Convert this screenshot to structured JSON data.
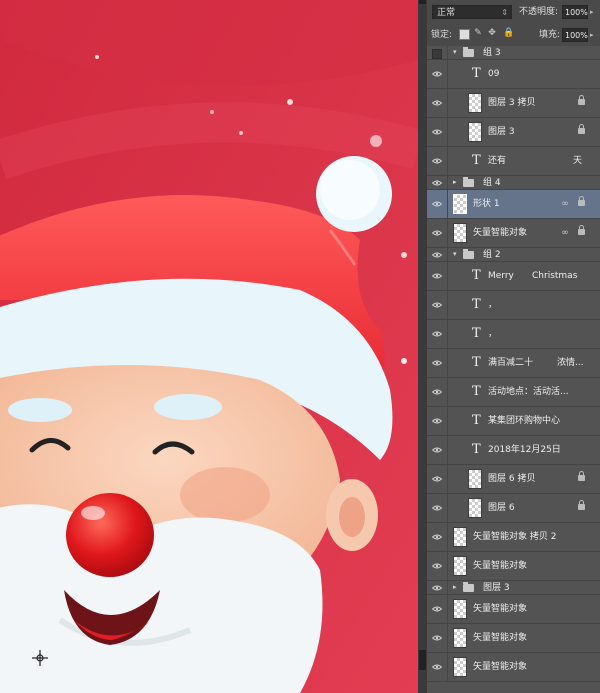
{
  "top_bar": {
    "blend_mode": "正常",
    "opacity_label": "不透明度:",
    "opacity_value": "100%",
    "lock_label": "锁定:",
    "fill_label": "填充:",
    "fill_value": "100%"
  },
  "layers": [
    {
      "kind": "group",
      "name": "组 3",
      "expanded": true,
      "indent": 0,
      "visible": false
    },
    {
      "kind": "text",
      "name": "09",
      "indent": 1,
      "visible": true
    },
    {
      "kind": "image",
      "name": "图层 3 拷贝",
      "indent": 1,
      "visible": true,
      "locked": true
    },
    {
      "kind": "image",
      "name": "图层 3",
      "indent": 1,
      "visible": true,
      "locked": true
    },
    {
      "kind": "text",
      "name": "还有",
      "extra": "天",
      "indent": 1,
      "visible": true
    },
    {
      "kind": "group",
      "name": "组 4",
      "expanded": false,
      "indent": 0,
      "visible": true
    },
    {
      "kind": "smart",
      "name": "形状 1",
      "indent": 0,
      "visible": true,
      "selected": true,
      "linked": true,
      "locked": true
    },
    {
      "kind": "smart",
      "name": "矢量智能对象",
      "indent": 0,
      "visible": true,
      "linked": true,
      "locked": true
    },
    {
      "kind": "group",
      "name": "组 2",
      "expanded": true,
      "indent": 0,
      "visible": true
    },
    {
      "kind": "text",
      "name": "Merry",
      "extra": "Christmas",
      "indent": 1,
      "visible": true
    },
    {
      "kind": "text",
      "name": "，",
      "indent": 1,
      "visible": true
    },
    {
      "kind": "text",
      "name": "，",
      "indent": 1,
      "visible": true
    },
    {
      "kind": "text",
      "name": "满百减二十",
      "extra": "浓情...",
      "indent": 1,
      "visible": true
    },
    {
      "kind": "text",
      "name": "活动地点：活动活...",
      "indent": 1,
      "visible": true
    },
    {
      "kind": "text",
      "name": "某集团环购物中心",
      "indent": 1,
      "visible": true
    },
    {
      "kind": "text",
      "name": "2018年12月25日",
      "indent": 1,
      "visible": true
    },
    {
      "kind": "image",
      "name": "图层 6 拷贝",
      "indent": 1,
      "visible": true,
      "locked": true
    },
    {
      "kind": "image",
      "name": "图层 6",
      "indent": 1,
      "visible": true,
      "locked": true
    },
    {
      "kind": "smart",
      "name": "矢量智能对象 拷贝 2",
      "indent": 0,
      "visible": true
    },
    {
      "kind": "smart",
      "name": "矢量智能对象",
      "indent": 0,
      "visible": true
    },
    {
      "kind": "group",
      "name": "图层 3",
      "expanded": false,
      "indent": 0,
      "visible": true
    },
    {
      "kind": "smart",
      "name": "矢量智能对象",
      "indent": 0,
      "visible": true
    },
    {
      "kind": "smart",
      "name": "矢量智能对象",
      "indent": 0,
      "visible": true
    },
    {
      "kind": "smart",
      "name": "矢量智能对象",
      "indent": 0,
      "visible": true
    }
  ],
  "icons": {
    "eye": "eye-icon",
    "lock": "lock-icon",
    "link": "link-icon",
    "folder": "folder-icon",
    "text_layer": "text-layer-icon"
  },
  "colors": {
    "canvas_red": "#d93448",
    "panel_bg": "#535353",
    "selected_row": "#65748b"
  }
}
